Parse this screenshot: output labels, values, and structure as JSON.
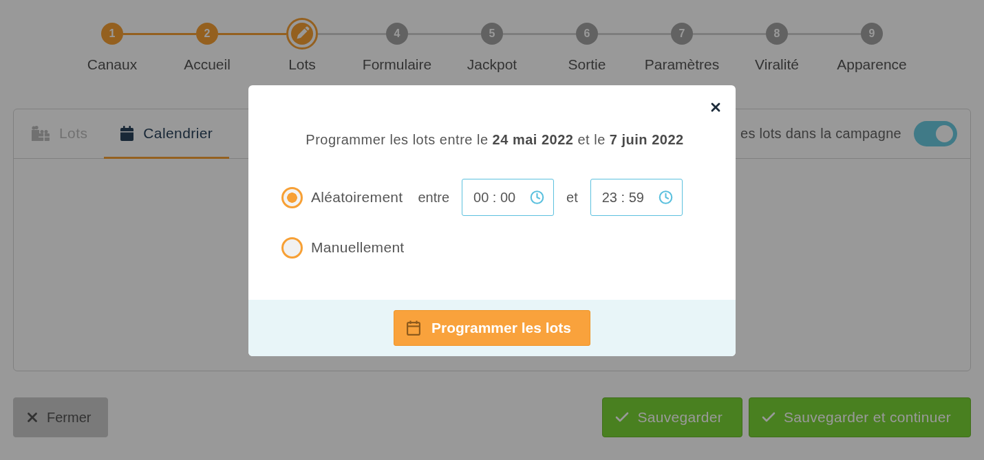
{
  "stepper": {
    "steps": [
      {
        "number": "1",
        "label": "Canaux",
        "completed": true,
        "selected": false
      },
      {
        "number": "2",
        "label": "Accueil",
        "completed": true,
        "selected": false
      },
      {
        "label": "Lots",
        "completed": false,
        "selected": true
      },
      {
        "number": "4",
        "label": "Formulaire",
        "completed": false,
        "selected": false
      },
      {
        "number": "5",
        "label": "Jackpot",
        "completed": false,
        "selected": false
      },
      {
        "number": "6",
        "label": "Sortie",
        "completed": false,
        "selected": false
      },
      {
        "number": "7",
        "label": "Paramètres",
        "completed": false,
        "selected": false
      },
      {
        "number": "8",
        "label": "Viralité",
        "completed": false,
        "selected": false
      },
      {
        "number": "9",
        "label": "Apparence",
        "completed": false,
        "selected": false
      }
    ]
  },
  "tabs": [
    {
      "label": "Lots",
      "selected": false
    },
    {
      "label": "Calendrier",
      "selected": true
    }
  ],
  "campaign_toggle": {
    "label": "es lots dans la campagne",
    "on": true
  },
  "footer_buttons": [
    {
      "label": "Fermer",
      "kind": "close"
    },
    {
      "label": "Sauvegarder",
      "kind": "save"
    },
    {
      "label": "Sauvegarder et continuer",
      "kind": "save"
    }
  ],
  "modal": {
    "title": "Programmer les lots entre le **24 mai 2022** et le **7 juin 2022**",
    "options": [
      {
        "label": "Aléatoirement",
        "selected": true,
        "range": {
          "from_label": "entre",
          "from": "00 : 00",
          "to_label": "et",
          "to": "23 : 59"
        }
      },
      {
        "label": "Manuellement",
        "selected": false
      }
    ],
    "submit": {
      "label": "Programmer les lots"
    }
  }
}
